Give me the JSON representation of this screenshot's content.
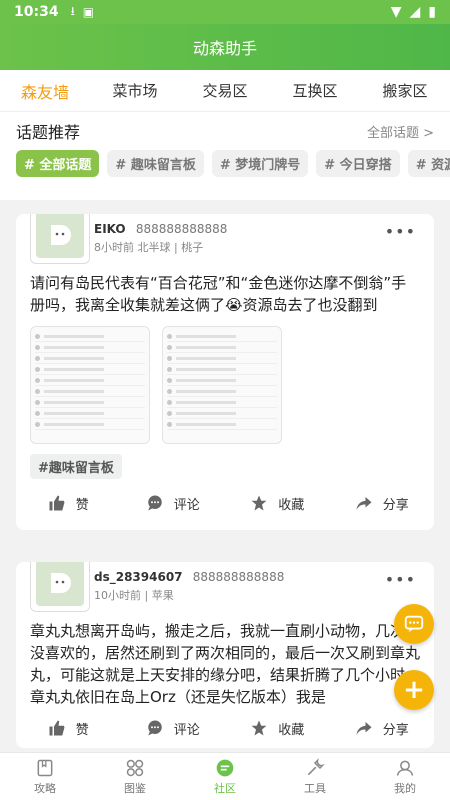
{
  "status": {
    "time": "10:34"
  },
  "app": {
    "title": "动森助手"
  },
  "tabs": [
    "森友墙",
    "菜市场",
    "交易区",
    "互换区",
    "搬家区"
  ],
  "topics": {
    "title": "话题推荐",
    "all_label": "全部话题 >",
    "chips": [
      "# 全部话题",
      "# 趣味留言板",
      "# 梦境门牌号",
      "# 今日穿搭",
      "# 资源"
    ]
  },
  "posts": [
    {
      "user": "EIKO",
      "uid": "888888888888",
      "meta": "8小时前   北半球   |   桃子",
      "text": "请问有岛民代表有“百合花冠”和“金色迷你达摩不倒翁”手册吗，我离全收集就差这俩了😭资源岛去了也没翻到",
      "tag": "#趣味留言板"
    },
    {
      "user": "ds_28394607",
      "uid": "888888888888",
      "meta": "10小时前   |   苹果",
      "text": "章丸丸想离开岛屿，搬走之后，我就一直刷小动物，几次都没喜欢的，居然还刷到了两次相同的，最后一次又刷到章丸丸，可能这就是上天安排的缘分吧，结果折腾了几个小时，章丸丸依旧在岛上Orz（还是失忆版本）我是"
    }
  ],
  "actions": {
    "like": "赞",
    "comment": "评论",
    "favorite": "收藏",
    "share": "分享"
  },
  "nav": [
    "攻略",
    "图鉴",
    "社区",
    "工具",
    "我的"
  ],
  "colors": {
    "primary": "#6cc24a",
    "accent": "#f39c12",
    "fab": "#f5b40a"
  }
}
